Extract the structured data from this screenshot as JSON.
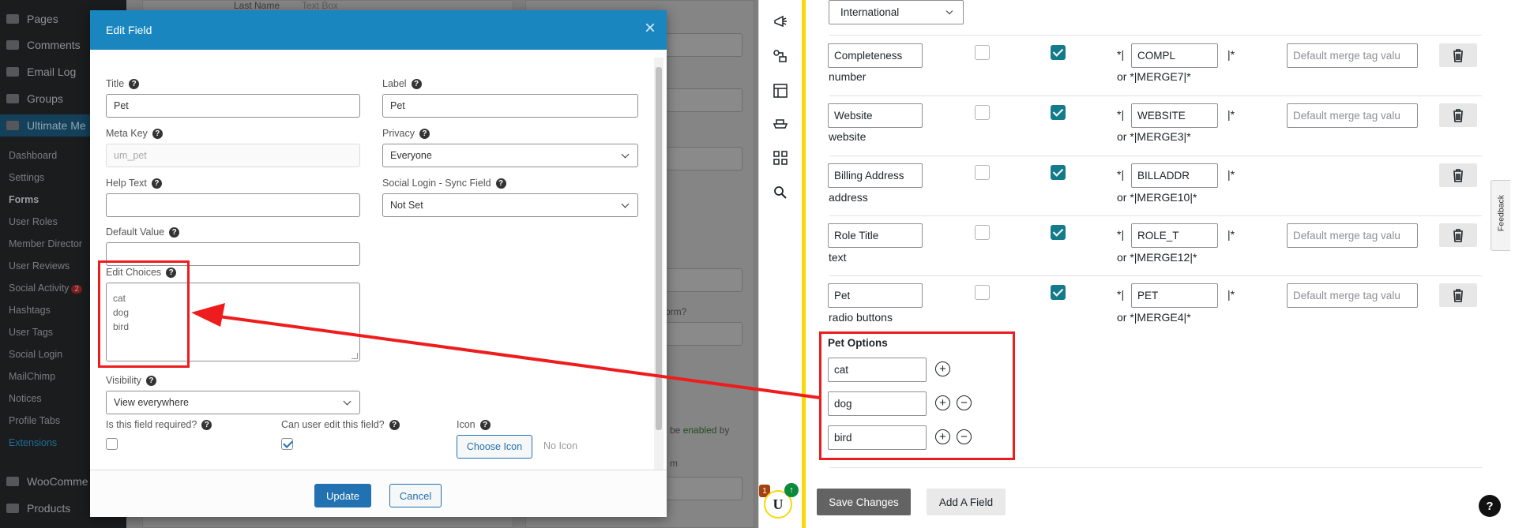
{
  "wp_sidebar": {
    "menu": [
      {
        "label": "Pages"
      },
      {
        "label": "Comments"
      },
      {
        "label": "Email Log"
      },
      {
        "label": "Groups"
      },
      {
        "label": "Ultimate Me"
      }
    ],
    "submenu": [
      {
        "label": "Dashboard"
      },
      {
        "label": "Settings"
      },
      {
        "label": "Forms"
      },
      {
        "label": "User Roles"
      },
      {
        "label": "Member Director"
      },
      {
        "label": "User Reviews"
      },
      {
        "label": "Social Activity",
        "badge": "2"
      },
      {
        "label": "Hashtags"
      },
      {
        "label": "User Tags"
      },
      {
        "label": "Social Login"
      },
      {
        "label": "MailChimp"
      },
      {
        "label": "Notices"
      },
      {
        "label": "Profile Tabs"
      },
      {
        "label": "Extensions"
      }
    ],
    "bottom_menu": [
      {
        "label": "WooComme"
      },
      {
        "label": "Products"
      }
    ]
  },
  "background": {
    "top_label": "Last Name",
    "top_value": "Text Box",
    "form_question": "orm?",
    "enabled_text": "be",
    "enabled_word": "enabled",
    "by_text": "by",
    "m_text": "m"
  },
  "modal": {
    "title": "Edit Field",
    "close_symbol": "×",
    "fields": {
      "title_label": "Title",
      "title_value": "Pet",
      "label_label": "Label",
      "label_value": "Pet",
      "metakey_label": "Meta Key",
      "metakey_value": "um_pet",
      "privacy_label": "Privacy",
      "privacy_value": "Everyone",
      "helptext_label": "Help Text",
      "helptext_value": "",
      "sociallogin_label": "Social Login - Sync Field",
      "sociallogin_value": "Not Set",
      "default_label": "Default Value",
      "default_value": "",
      "choices_label": "Edit Choices",
      "choices": [
        "cat",
        "dog",
        "bird"
      ],
      "visibility_label": "Visibility",
      "visibility_value": "View everywhere",
      "required_label": "Is this field required?",
      "required_checked": false,
      "editable_label": "Can user edit this field?",
      "editable_checked": true,
      "icon_label": "Icon",
      "choose_icon_label": "Choose Icon",
      "no_icon_label": "No Icon"
    },
    "update_label": "Update",
    "cancel_label": "Cancel",
    "help_symbol": "?"
  },
  "right_panel": {
    "top_select": "International",
    "rows": [
      {
        "name": "Completeness",
        "type": "number",
        "tag": "COMPL",
        "merge": "*|MERGE7|*",
        "placeholder": "Default merge tag valu",
        "show_default": true
      },
      {
        "name": "Website",
        "type": "website",
        "tag": "WEBSITE",
        "merge": "*|MERGE3|*",
        "placeholder": "Default merge tag valu",
        "show_default": true
      },
      {
        "name": "Billing Address",
        "type": "address",
        "tag": "BILLADDR",
        "merge": "*|MERGE10|*",
        "placeholder": "",
        "show_default": false
      },
      {
        "name": "Role Title",
        "type": "text",
        "tag": "ROLE_T",
        "merge": "*|MERGE12|*",
        "placeholder": "Default merge tag valu",
        "show_default": true
      },
      {
        "name": "Pet",
        "type": "radio buttons",
        "tag": "PET",
        "merge": "*|MERGE4|*",
        "placeholder": "Default merge tag valu",
        "show_default": true
      }
    ],
    "merge_prefix": "*|",
    "merge_suffix": "|*",
    "or_label": "or",
    "pet_options_title": "Pet Options",
    "pet_options": [
      "cat",
      "dog",
      "bird"
    ],
    "save_label": "Save Changes",
    "add_field_label": "Add A Field",
    "feedback_label": "Feedback",
    "help_symbol": "?",
    "avatar_letter": "U",
    "avatar_notif": "1",
    "avatar_up": "↑"
  },
  "colors": {
    "modal_header": "#1986c0",
    "primary_button": "#2271b1",
    "highlight": "#ee1c1c",
    "checkbox_checked": "#137b8a",
    "accent_bar": "#f5d90a"
  }
}
